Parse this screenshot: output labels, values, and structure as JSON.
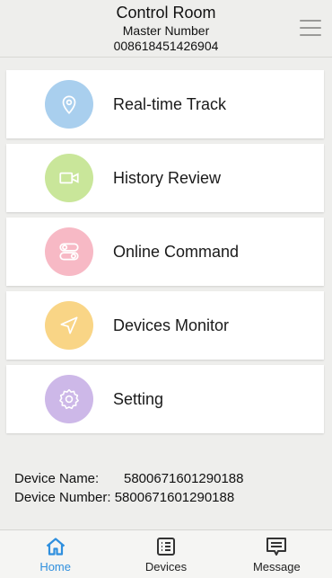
{
  "header": {
    "title": "Control Room",
    "subtitle": "Master Number",
    "number": "008618451426904",
    "menu_icon": "hamburger-icon"
  },
  "menu": [
    {
      "label": "Real-time Track",
      "icon": "location-pin-icon",
      "color": "#a9cfee"
    },
    {
      "label": "History Review",
      "icon": "video-camera-icon",
      "color": "#c9e69a"
    },
    {
      "label": "Online Command",
      "icon": "toggle-switches-icon",
      "color": "#f7b9c5"
    },
    {
      "label": "Devices Monitor",
      "icon": "navigation-arrow-icon",
      "color": "#f9d586"
    },
    {
      "label": "Setting",
      "icon": "gear-icon",
      "color": "#cdb8e8"
    }
  ],
  "device": {
    "name_label": "Device Name:",
    "name_value": "5800671601290188",
    "number_label": "Device Number:",
    "number_value": "5800671601290188"
  },
  "tabs": [
    {
      "label": "Home",
      "icon": "home-icon",
      "active": true
    },
    {
      "label": "Devices",
      "icon": "device-list-icon",
      "active": false
    },
    {
      "label": "Message",
      "icon": "message-icon",
      "active": false
    }
  ],
  "colors": {
    "accent": "#2f8fde",
    "background": "#eeeeec"
  }
}
